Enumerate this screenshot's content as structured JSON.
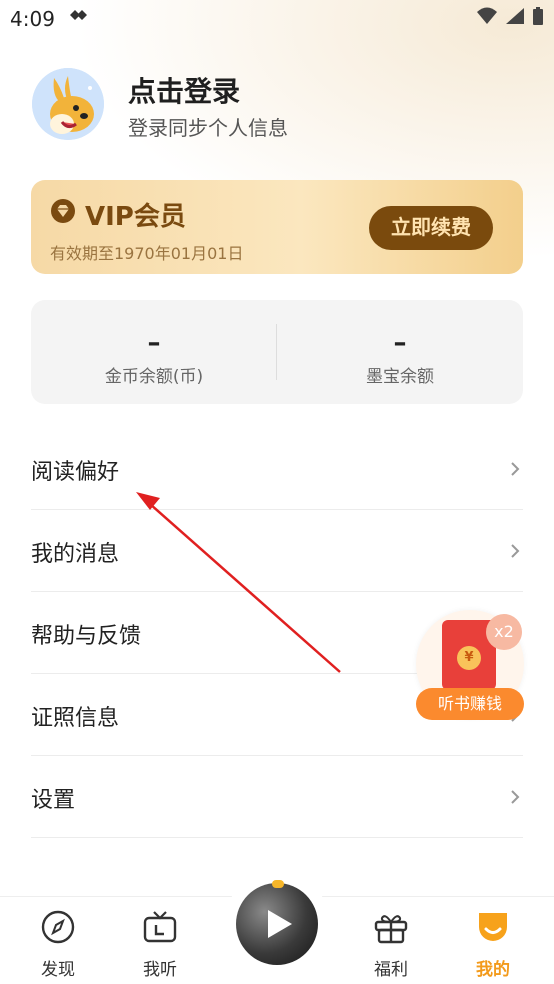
{
  "status_bar": {
    "time": "4:09",
    "notification_icon": "kite-icon",
    "wifi_icon": "wifi-icon",
    "signal_icon": "signal-icon",
    "battery_icon": "battery-icon"
  },
  "profile": {
    "avatar_icon": "kangaroo-avatar",
    "title": "点击登录",
    "subtitle": "登录同步个人信息"
  },
  "vip": {
    "icon": "diamond-icon",
    "title": "VIP会员",
    "expiry": "有效期至1970年01月01日",
    "renew_label": "立即续费"
  },
  "balance": {
    "coins": {
      "value": "–",
      "label": "金币余额(币)"
    },
    "treasure": {
      "value": "–",
      "label": "墨宝余额"
    }
  },
  "menu": [
    {
      "label": "阅读偏好"
    },
    {
      "label": "我的消息"
    },
    {
      "label": "帮助与反馈"
    },
    {
      "label": "证照信息"
    },
    {
      "label": "设置"
    }
  ],
  "float_widget": {
    "badge": "x2",
    "coin": "¥",
    "label": "听书赚钱"
  },
  "tabs": [
    {
      "label": "发现",
      "icon": "compass-icon"
    },
    {
      "label": "我听",
      "icon": "tv-icon"
    },
    {
      "label": "福利",
      "icon": "gift-icon"
    },
    {
      "label": "我的",
      "icon": "smile-icon"
    }
  ],
  "colors": {
    "accent": "#f39a1b",
    "vip_brown": "#7a4a0d",
    "annotation": "#e02020"
  }
}
